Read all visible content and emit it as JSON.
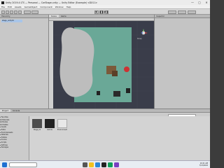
{
  "window": {
    "title": "Unity 2019.4 LTS — Personal — CarStage.unity — Unity Editor (Example) <DX11>",
    "min": "—",
    "max": "▢",
    "close": "✕"
  },
  "menu": [
    "File",
    "Edit",
    "Assets",
    "GameObject",
    "Component",
    "Window",
    "Help"
  ],
  "toolbar": {
    "play": "▶",
    "pause": "❚❚",
    "step": "▶❚"
  },
  "hierarchy": {
    "tab": "Hierarchy",
    "selected": "stage_unity01"
  },
  "scene": {
    "tabs": [
      "Scene",
      "Game"
    ],
    "label": "Persp"
  },
  "inspector": {
    "tab": "Inspector"
  },
  "bottom": {
    "tabs": [
      "Project",
      "Console"
    ],
    "tree": [
      "▾ Favorites",
      "  All Materials",
      "  All Models",
      "  All Prefabs",
      "▾ Assets",
      "  ▸ Editor",
      "  ▸ ExampleAssets",
      "  ▸ Materials",
      "  ▸ Prefabs",
      "  ▸ Scenes",
      "  ▸ Scripts",
      "  ▸ Settings",
      "▸ Packages"
    ],
    "assets": [
      {
        "label": "Stage_01"
      },
      {
        "label": "Vehicle"
      },
      {
        "label": "Environment"
      }
    ]
  },
  "taskbar": {
    "time": "10:21 AM",
    "date": "7/13/2022"
  },
  "colors": {
    "ground": "#6aa897",
    "sceneBg": "#3a3d4a",
    "rock": "#bdbdbd"
  }
}
